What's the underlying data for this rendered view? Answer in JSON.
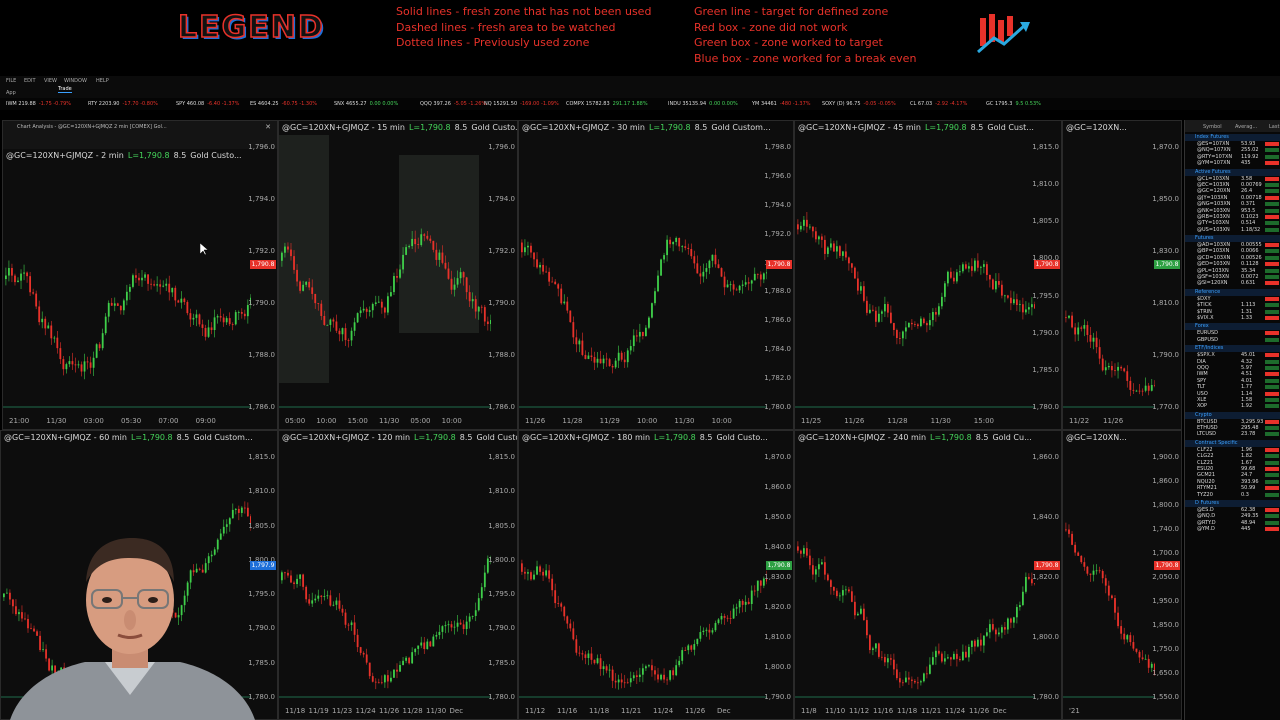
{
  "legend": {
    "title": "LEGEND",
    "line_notes": [
      "Solid lines - fresh zone that has not been used",
      "Dashed lines - fresh area to be watched",
      "Dotted lines - Previously used zone"
    ],
    "box_notes": [
      "Green line - target for defined zone",
      "Red box - zone did not work",
      "Green box - zone worked to target",
      "Blue box - zone worked for a break even"
    ],
    "note_color": "#e8322a"
  },
  "menu": {
    "items": [
      "FILE",
      "EDIT",
      "VIEW",
      "WINDOW",
      "HELP"
    ],
    "sub": [
      "App",
      "Trade"
    ]
  },
  "ticker": [
    {
      "sym": "IWM 219.88",
      "chg": "-1.75 -0.79%",
      "up": false
    },
    {
      "sym": "RTY 2203.90",
      "chg": "-17.70 -0.80%",
      "up": false
    },
    {
      "sym": "SPY 460.08",
      "chg": "-6.40 -1.37%",
      "up": false
    },
    {
      "sym": "ES 4604.25",
      "chg": "-60.75 -1.30%",
      "up": false
    },
    {
      "sym": "SNX 4655.27",
      "chg": "0.00 0.00%",
      "up": true
    },
    {
      "sym": "QQQ 397.26",
      "chg": "-5.05 -1.26%",
      "up": false
    },
    {
      "sym": "NQ 15291.50",
      "chg": "-169.00 -1.09%",
      "up": false
    },
    {
      "sym": "COMPX 15782.83",
      "chg": "291.17 1.88%",
      "up": true
    },
    {
      "sym": "INDU 35135.94",
      "chg": "0.00 0.00%",
      "up": true
    },
    {
      "sym": "YM 34461",
      "chg": "-480 -1.37%",
      "up": false
    },
    {
      "sym": "SOXY (D) 96.75",
      "chg": "-0.05 -0.05%",
      "up": false
    },
    {
      "sym": "CL 67.03",
      "chg": "-2.92 -4.17%",
      "up": false
    },
    {
      "sym": "GC 1795.3",
      "chg": "9.5 0.53%",
      "up": true
    }
  ],
  "charts": [
    {
      "title": "@GC=120XN+GJMQZ - 2 min",
      "price": "L=1,790.8",
      "extra": "8.5",
      "name": "Gold Custo...",
      "yticks": [
        "1,796.0",
        "1,794.0",
        "1,792.0",
        "1,790.0",
        "1,788.0",
        "1,786.0"
      ],
      "xticks": [
        "21:00",
        "11/30",
        "03:00",
        "05:30",
        "07:00",
        "09:00"
      ],
      "badge": "1,790.8",
      "badge_color": "#e8322a",
      "panel": "Chart Analysis - @GC=120XN+GJMQZ 2 min [COMEX] Gol...",
      "seed": 1
    },
    {
      "title": "@GC=120XN+GJMQZ - 15 min",
      "price": "L=1,790.8",
      "extra": "8.5",
      "name": "Gold Custo...",
      "yticks": [
        "1,796.0",
        "1,794.0",
        "1,792.0",
        "1,790.0",
        "1,788.0",
        "1,786.0"
      ],
      "xticks": [
        "05:00",
        "10:00",
        "15:00",
        "11/30",
        "05:00",
        "10:00"
      ],
      "badge": "",
      "badge_color": "#e8322a",
      "seed": 2
    },
    {
      "title": "@GC=120XN+GJMQZ - 30 min",
      "price": "L=1,790.8",
      "extra": "8.5",
      "name": "Gold Custom...",
      "yticks": [
        "1,798.0",
        "1,796.0",
        "1,794.0",
        "1,792.0",
        "1,790.0",
        "1,788.0",
        "1,786.0",
        "1,784.0",
        "1,782.0",
        "1,780.0"
      ],
      "xticks": [
        "11/26",
        "11/28",
        "11/29",
        "10:00",
        "11/30",
        "10:00"
      ],
      "badge": "1,790.8",
      "badge_color": "#e8322a",
      "seed": 3
    },
    {
      "title": "@GC=120XN+GJMQZ - 45 min",
      "price": "L=1,790.8",
      "extra": "8.5",
      "name": "Gold Cust...",
      "yticks": [
        "1,815.0",
        "1,810.0",
        "1,805.0",
        "1,800.0",
        "1,795.0",
        "1,790.0",
        "1,785.0",
        "1,780.0"
      ],
      "xticks": [
        "11/25",
        "11/26",
        "11/28",
        "11/30",
        "15:00"
      ],
      "badge": "1,790.8",
      "badge_color": "#e8322a",
      "seed": 4
    },
    {
      "title": "@GC=120XN...",
      "price": "",
      "extra": "",
      "name": "",
      "yticks": [
        "1,870.0",
        "1,850.0",
        "1,830.0",
        "1,810.0",
        "1,790.0",
        "1,770.0"
      ],
      "xticks": [
        "11/22",
        "11/26"
      ],
      "badge": "1,790.8",
      "badge_color": "#2ea043",
      "seed": 5
    },
    {
      "title": "@GC=120XN+GJMQZ - 60 min",
      "price": "L=1,790.8",
      "extra": "8.5",
      "name": "Gold Custom...",
      "yticks": [
        "1,815.0",
        "1,810.0",
        "1,805.0",
        "1,800.0",
        "1,795.0",
        "1,790.0",
        "1,785.0",
        "1,780.0"
      ],
      "xticks": [],
      "badge": "1,797.9",
      "badge_color": "#1e6fd9",
      "seed": 6
    },
    {
      "title": "@GC=120XN+GJMQZ - 120 min",
      "price": "L=1,790.8",
      "extra": "8.5",
      "name": "Gold Custom...",
      "yticks": [
        "1,815.0",
        "1,810.0",
        "1,805.0",
        "1,800.0",
        "1,795.0",
        "1,790.0",
        "1,785.0",
        "1,780.0"
      ],
      "xticks": [
        "11/18",
        "11/19",
        "11/23",
        "11/24",
        "11/26",
        "11/28",
        "11/30",
        "Dec"
      ],
      "badge": "",
      "badge_color": "#e8322a",
      "seed": 7
    },
    {
      "title": "@GC=120XN+GJMQZ - 180 min",
      "price": "L=1,790.8",
      "extra": "8.5",
      "name": "Gold Custo...",
      "yticks": [
        "1,870.0",
        "1,860.0",
        "1,850.0",
        "1,840.0",
        "1,830.0",
        "1,820.0",
        "1,810.0",
        "1,800.0",
        "1,790.0"
      ],
      "xticks": [
        "11/12",
        "11/16",
        "11/18",
        "11/21",
        "11/24",
        "11/26",
        "Dec"
      ],
      "badge": "1,790.8",
      "badge_color": "#2ea043",
      "seed": 8
    },
    {
      "title": "@GC=120XN+GJMQZ - 240 min",
      "price": "L=1,790.8",
      "extra": "8.5",
      "name": "Gold Cu...",
      "yticks": [
        "1,860.0",
        "1,840.0",
        "1,820.0",
        "1,800.0",
        "1,780.0"
      ],
      "xticks": [
        "11/8",
        "11/10",
        "11/12",
        "11/16",
        "11/18",
        "11/21",
        "11/24",
        "11/26",
        "Dec"
      ],
      "badge": "1,790.8",
      "badge_color": "#e8322a",
      "seed": 9
    },
    {
      "title": "@GC=120XN...",
      "price": "",
      "extra": "",
      "name": "",
      "yticks": [
        "1,900.0",
        "1,860.0",
        "1,800.0",
        "1,740.0",
        "1,700.0",
        "2,050.0",
        "1,950.0",
        "1,850.0",
        "1,750.0",
        "1,650.0",
        "1,550.0"
      ],
      "xticks": [
        "'21"
      ],
      "badge": "1,790.8",
      "badge_color": "#e8322a",
      "seed": 10
    }
  ],
  "watchlist": {
    "headers": [
      "Symbol",
      "Averag...",
      "Last"
    ],
    "sections": [
      {
        "name": "Index Futures",
        "rows": [
          [
            "@ES=107XN",
            "53.93",
            ""
          ],
          [
            "@NQ=107XN",
            "255.02",
            ""
          ],
          [
            "@RTY=107XN",
            "119.92",
            ""
          ],
          [
            "@YM=107XN",
            "435",
            ""
          ]
        ]
      },
      {
        "name": "Active Futures",
        "rows": [
          [
            "@CL=103XN",
            "3.58",
            ""
          ],
          [
            "@EC=103XN",
            "0.00769",
            ""
          ],
          [
            "@GC=120XN",
            "26.4",
            ""
          ],
          [
            "@JY=103XN",
            "0.00718",
            ""
          ],
          [
            "@NG=103XN",
            "0.371",
            ""
          ],
          [
            "@NK=103XN",
            "953.5",
            ""
          ],
          [
            "@RB=103XN",
            "0.1023",
            ""
          ],
          [
            "@TY=103XN",
            "0.514",
            ""
          ],
          [
            "@US=103XN",
            "1.18/32",
            ""
          ]
        ]
      },
      {
        "name": "Futures",
        "rows": [
          [
            "@AD=103XN",
            "0.00555",
            ""
          ],
          [
            "@BP=103XN",
            "0.0066",
            ""
          ],
          [
            "@CD=103XN",
            "0.00526",
            ""
          ],
          [
            "@ED=103XN",
            "0.1128",
            ""
          ],
          [
            "@PL=103XN",
            "35.34",
            ""
          ],
          [
            "@SF=103XN",
            "0.0072",
            ""
          ],
          [
            "@SI=120XN",
            "0.631",
            ""
          ]
        ]
      },
      {
        "name": "Reference",
        "rows": [
          [
            "$DXY",
            "",
            ""
          ],
          [
            "$TICK",
            "1.113",
            ""
          ],
          [
            "$TRIN",
            "1.31",
            ""
          ],
          [
            "$VIX.X",
            "1.33",
            ""
          ]
        ]
      },
      {
        "name": "Forex",
        "rows": [
          [
            "EURUSD",
            "",
            ""
          ],
          [
            "GBPUSD",
            "",
            ""
          ]
        ]
      },
      {
        "name": "ETF/Indices",
        "rows": [
          [
            "$SPX.X",
            "45.01",
            ""
          ],
          [
            "DIA",
            "4.32",
            ""
          ],
          [
            "QQQ",
            "5.97",
            ""
          ],
          [
            "IWM",
            "4.51",
            ""
          ],
          [
            "SPY",
            "4.01",
            ""
          ],
          [
            "TLT",
            "1.77",
            ""
          ],
          [
            "USO",
            "1.14",
            ""
          ],
          [
            "XLE",
            "1.58",
            ""
          ],
          [
            "XOP",
            "1.92",
            ""
          ]
        ]
      },
      {
        "name": "Crypto",
        "rows": [
          [
            "BTCUSD",
            "3,295.93",
            ""
          ],
          [
            "ETHUSD",
            "295.48",
            ""
          ],
          [
            "LTCUSD",
            "23.78",
            ""
          ]
        ]
      },
      {
        "name": "Contract Specific",
        "rows": [
          [
            "CLF22",
            "1.96",
            ""
          ],
          [
            "CLG22",
            "1.82",
            ""
          ],
          [
            "CLZ21",
            "1.67",
            ""
          ],
          [
            "ESU20",
            "99.68",
            ""
          ],
          [
            "GCM21",
            "24.7",
            ""
          ],
          [
            "NQU20",
            "393.96",
            ""
          ],
          [
            "RTYM21",
            "50.99",
            ""
          ],
          [
            "TYZ20",
            "0.3",
            ""
          ]
        ]
      },
      {
        "name": "D Futures",
        "rows": [
          [
            "@ES.D",
            "62.38",
            ""
          ],
          [
            "@NQ.D",
            "249.35",
            ""
          ],
          [
            "@RTY.D",
            "48.94",
            ""
          ],
          [
            "@YM.D",
            "445",
            ""
          ]
        ]
      }
    ]
  }
}
